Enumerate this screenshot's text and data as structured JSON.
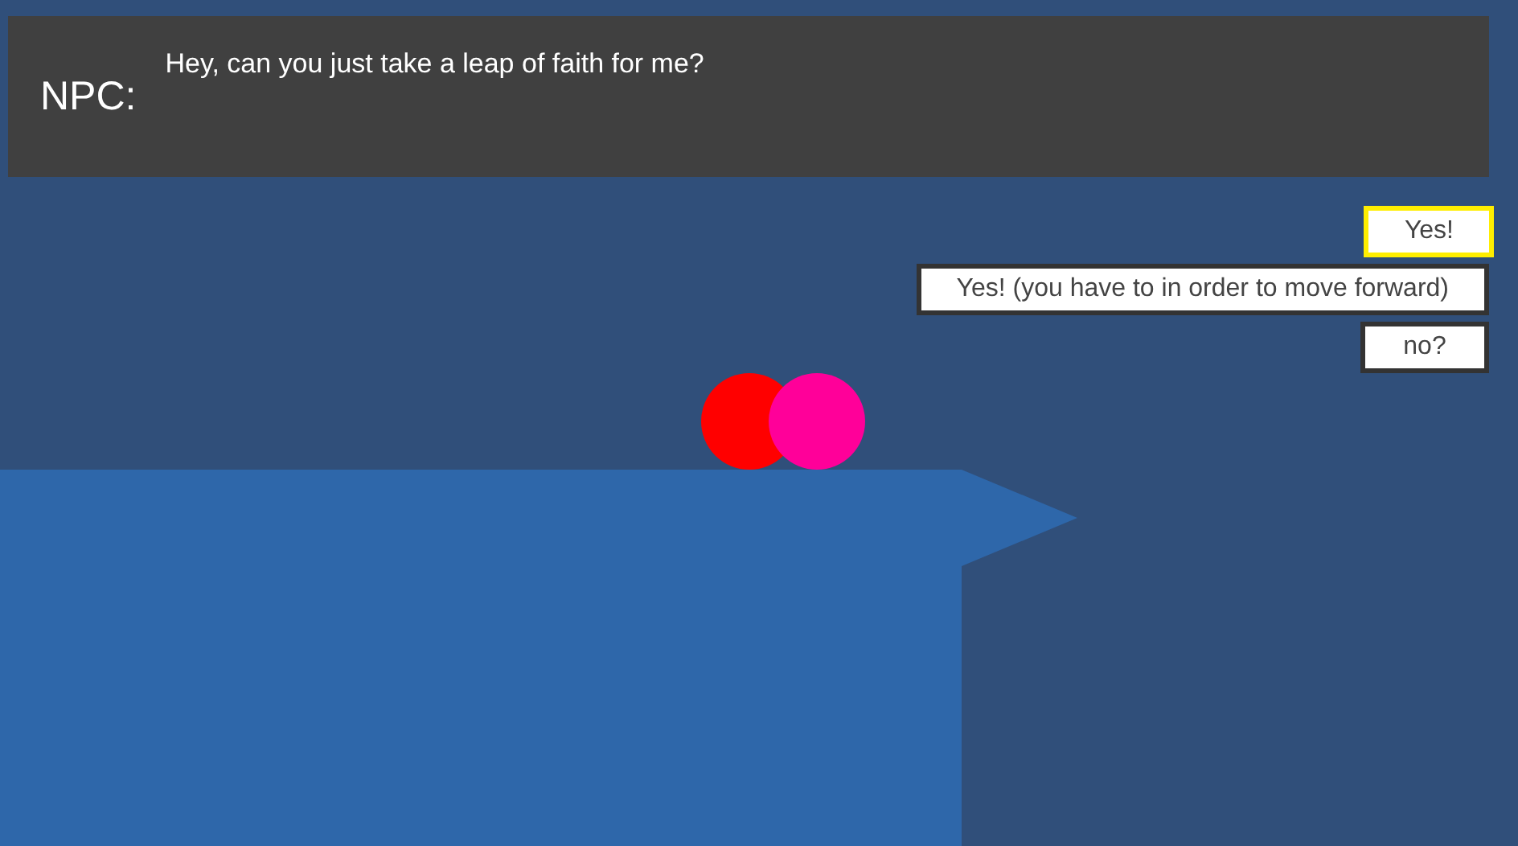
{
  "dialog": {
    "speaker": "NPC:",
    "line": "Hey, can you just take a leap of faith for me?"
  },
  "choices": [
    {
      "label": "Yes!",
      "selected": true
    },
    {
      "label": "Yes! (you have to in order to move forward)",
      "selected": false
    },
    {
      "label": "no?",
      "selected": false
    }
  ]
}
